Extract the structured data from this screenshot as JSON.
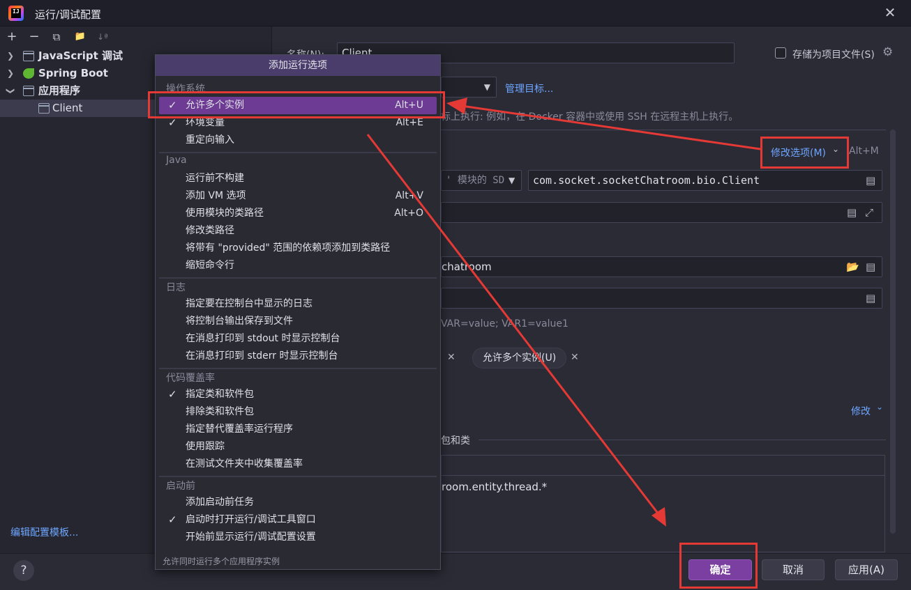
{
  "window": {
    "title": "运行/调试配置",
    "app_logo_text": "IJ"
  },
  "toolbar": {
    "add": "+",
    "remove": "−",
    "copy": "⧉",
    "new_folder": "📁",
    "sort": "↓ª"
  },
  "tree": {
    "items": [
      {
        "label": "JavaScript 调试",
        "icon": "js-debug-icon"
      },
      {
        "label": "Spring Boot",
        "icon": "spring-boot-icon"
      },
      {
        "label": "应用程序",
        "icon": "application-icon"
      },
      {
        "label": "Client",
        "icon": "application-icon"
      }
    ]
  },
  "edit_template": "编辑配置模板...",
  "form": {
    "name_label": "名称(N):",
    "name_value": "Client",
    "store_as_project_file": "存储为项目文件(S)",
    "manage_targets": "管理目标...",
    "run_target_hint": "标上执行: 例如，在 Docker 容器中或使用 SSH 在远程主机上执行。",
    "modify_options": "修改选项(M)",
    "modify_options_shortcut": "Alt+M",
    "sdk_value": "' 模块的 SD",
    "main_class": "com.socket.socketChatroom.bio.Client",
    "working_dir": "chatroom",
    "env_hint": "VAR=value; VAR1=value1",
    "chip_allow_multiple": "允许多个实例(U)",
    "modify_link": "修改",
    "packages_label": "包和类",
    "package_entry": "room.entity.thread.*"
  },
  "popup": {
    "header": "添加运行选项",
    "sections": [
      {
        "title": "操作系统",
        "items": [
          {
            "label": "允许多个实例",
            "shortcut": "Alt+U",
            "checked": true,
            "active": true
          },
          {
            "label": "环境变量",
            "shortcut": "Alt+E",
            "checked": true
          },
          {
            "label": "重定向输入",
            "shortcut": "",
            "checked": false
          }
        ]
      },
      {
        "title": "Java",
        "items": [
          {
            "label": "运行前不构建",
            "shortcut": "",
            "checked": false
          },
          {
            "label": "添加 VM 选项",
            "shortcut": "Alt+V",
            "checked": false
          },
          {
            "label": "使用模块的类路径",
            "shortcut": "Alt+O",
            "checked": false
          },
          {
            "label": "修改类路径",
            "shortcut": "",
            "checked": false
          },
          {
            "label": "将带有 \"provided\" 范围的依赖项添加到类路径",
            "shortcut": "",
            "checked": false
          },
          {
            "label": "缩短命令行",
            "shortcut": "",
            "checked": false
          }
        ]
      },
      {
        "title": "日志",
        "items": [
          {
            "label": "指定要在控制台中显示的日志",
            "shortcut": "",
            "checked": false
          },
          {
            "label": "将控制台输出保存到文件",
            "shortcut": "",
            "checked": false
          },
          {
            "label": "在消息打印到 stdout 时显示控制台",
            "shortcut": "",
            "checked": false
          },
          {
            "label": "在消息打印到 stderr 时显示控制台",
            "shortcut": "",
            "checked": false
          }
        ]
      },
      {
        "title": "代码覆盖率",
        "items": [
          {
            "label": "指定类和软件包",
            "shortcut": "",
            "checked": true
          },
          {
            "label": "排除类和软件包",
            "shortcut": "",
            "checked": false
          },
          {
            "label": "指定替代覆盖率运行程序",
            "shortcut": "",
            "checked": false
          },
          {
            "label": "使用跟踪",
            "shortcut": "",
            "checked": false
          },
          {
            "label": "在测试文件夹中收集覆盖率",
            "shortcut": "",
            "checked": false
          }
        ]
      },
      {
        "title": "启动前",
        "items": [
          {
            "label": "添加启动前任务",
            "shortcut": "",
            "checked": false
          },
          {
            "label": "启动时打开运行/调试工具窗口",
            "shortcut": "",
            "checked": true
          },
          {
            "label": "开始前显示运行/调试配置设置",
            "shortcut": "",
            "checked": false
          }
        ]
      }
    ],
    "footer": "允许同时运行多个应用程序实例",
    "check_glyph": "✓"
  },
  "buttons": {
    "ok": "确定",
    "cancel": "取消",
    "apply": "应用(A)",
    "help": "?"
  },
  "colors": {
    "accent": "#7a3fa0",
    "annotation_red": "#e53935",
    "link": "#6ea6ff"
  }
}
